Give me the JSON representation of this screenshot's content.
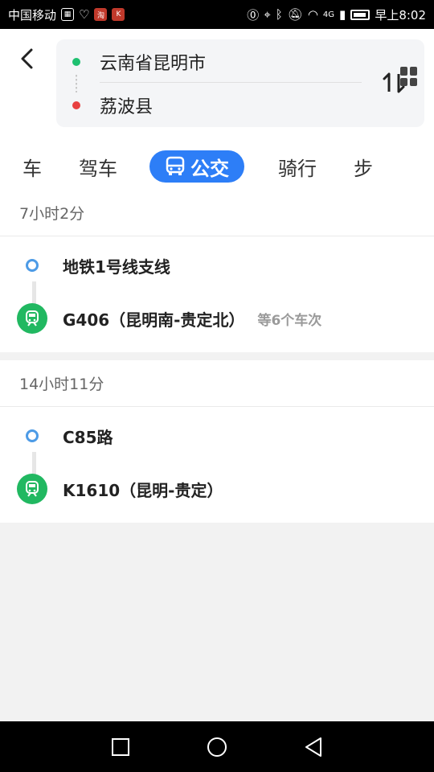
{
  "status_bar": {
    "carrier": "中国移动",
    "app_badges": [
      "淘",
      "K"
    ],
    "network": "4G",
    "time": "早上8:02"
  },
  "route": {
    "origin": "云南省昆明市",
    "destination": "荔波县"
  },
  "tabs": [
    {
      "label": "叫车",
      "visible": "车"
    },
    {
      "label": "驾车"
    },
    {
      "label": "公交",
      "active": true
    },
    {
      "label": "骑行"
    },
    {
      "label": "步行",
      "visible": "步"
    }
  ],
  "results": [
    {
      "duration": "7小时2分",
      "segments": [
        {
          "type": "subway",
          "name": "地铁1号线支线"
        },
        {
          "type": "train",
          "name": "G406（昆明南-贵定北）",
          "note": "等6个车次"
        }
      ]
    },
    {
      "duration": "14小时11分",
      "segments": [
        {
          "type": "subway",
          "name": "C85路"
        },
        {
          "type": "train",
          "name": "K1610（昆明-贵定）"
        }
      ]
    }
  ],
  "colors": {
    "accent": "#2d7ef7",
    "origin_dot": "#1ec070",
    "destination_dot": "#e84040",
    "train": "#21b861",
    "subway": "#4d9be6"
  }
}
